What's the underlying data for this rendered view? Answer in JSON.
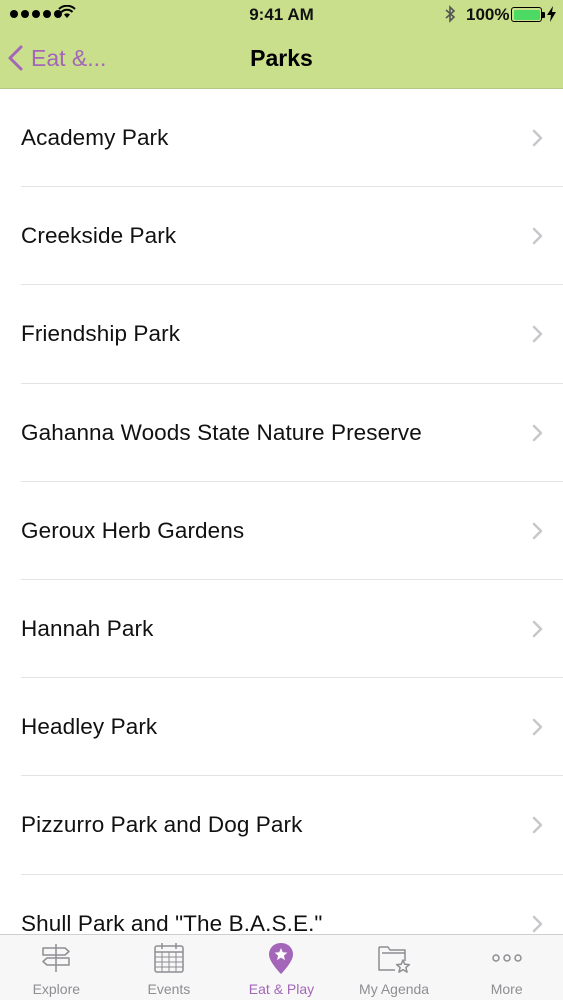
{
  "status_bar": {
    "time": "9:41 AM",
    "battery_percent": "100%",
    "icons": [
      "signal-dots-icon",
      "wifi-icon",
      "bluetooth-icon",
      "battery-icon",
      "charging-bolt-icon"
    ]
  },
  "navbar": {
    "back_label": "Eat &...",
    "title": "Parks",
    "accent_color": "#a366b8",
    "background_color": "#c9df8c"
  },
  "parks": [
    {
      "label": "Academy Park"
    },
    {
      "label": "Creekside Park"
    },
    {
      "label": "Friendship Park"
    },
    {
      "label": "Gahanna Woods State Nature Preserve"
    },
    {
      "label": "Geroux Herb Gardens"
    },
    {
      "label": "Hannah Park"
    },
    {
      "label": "Headley Park"
    },
    {
      "label": "Pizzurro Park and Dog Park"
    },
    {
      "label": "Shull Park and \"The B.A.S.E.\""
    }
  ],
  "tabbar": {
    "tabs": [
      {
        "label": "Explore",
        "icon": "signpost-icon",
        "active": false
      },
      {
        "label": "Events",
        "icon": "calendar-icon",
        "active": false
      },
      {
        "label": "Eat & Play",
        "icon": "map-pin-star-icon",
        "active": true
      },
      {
        "label": "My Agenda",
        "icon": "folder-star-icon",
        "active": false
      },
      {
        "label": "More",
        "icon": "more-dots-icon",
        "active": false
      }
    ]
  }
}
